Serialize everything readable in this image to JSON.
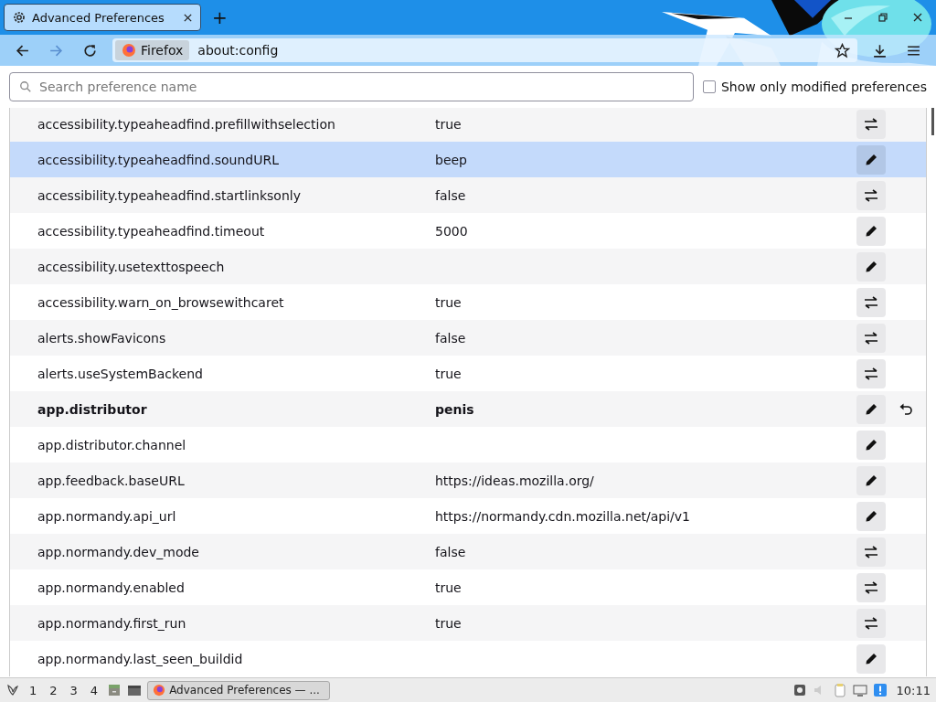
{
  "window": {
    "tab_title": "Advanced Preferences",
    "new_tab": "+"
  },
  "toolbar": {
    "identity": "Firefox",
    "url": "about:config"
  },
  "search": {
    "placeholder": "Search preference name"
  },
  "filter": {
    "label": "Show only modified preferences",
    "checked": false
  },
  "preferences": [
    {
      "name": "accessibility.typeaheadfind.prefillwithselection",
      "value": "true",
      "kind": "toggle",
      "modified": false,
      "selected": false
    },
    {
      "name": "accessibility.typeaheadfind.soundURL",
      "value": "beep",
      "kind": "edit",
      "modified": false,
      "selected": true
    },
    {
      "name": "accessibility.typeaheadfind.startlinksonly",
      "value": "false",
      "kind": "toggle",
      "modified": false,
      "selected": false
    },
    {
      "name": "accessibility.typeaheadfind.timeout",
      "value": "5000",
      "kind": "edit",
      "modified": false,
      "selected": false
    },
    {
      "name": "accessibility.usetexttospeech",
      "kind": "edit",
      "modified": false,
      "selected": false
    },
    {
      "name": "accessibility.warn_on_browsewithcaret",
      "value": "true",
      "kind": "toggle",
      "modified": false,
      "selected": false
    },
    {
      "name": "alerts.showFavicons",
      "value": "false",
      "kind": "toggle",
      "modified": false,
      "selected": false
    },
    {
      "name": "alerts.useSystemBackend",
      "value": "true",
      "kind": "toggle",
      "modified": false,
      "selected": false
    },
    {
      "name": "app.distributor",
      "value": "penis",
      "kind": "edit",
      "modified": true,
      "selected": false
    },
    {
      "name": "app.distributor.channel",
      "kind": "edit",
      "modified": false,
      "selected": false
    },
    {
      "name": "app.feedback.baseURL",
      "value": "https://ideas.mozilla.org/",
      "kind": "edit",
      "modified": false,
      "selected": false
    },
    {
      "name": "app.normandy.api_url",
      "value": "https://normandy.cdn.mozilla.net/api/v1",
      "kind": "edit",
      "modified": false,
      "selected": false
    },
    {
      "name": "app.normandy.dev_mode",
      "value": "false",
      "kind": "toggle",
      "modified": false,
      "selected": false
    },
    {
      "name": "app.normandy.enabled",
      "value": "true",
      "kind": "toggle",
      "modified": false,
      "selected": false
    },
    {
      "name": "app.normandy.first_run",
      "value": "true",
      "kind": "toggle",
      "modified": false,
      "selected": false
    },
    {
      "name": "app.normandy.last_seen_buildid",
      "kind": "edit",
      "modified": false,
      "selected": false
    }
  ],
  "taskbar": {
    "workspaces": [
      "1",
      "2",
      "3",
      "4"
    ],
    "task": "Advanced Preferences — ...",
    "clock": "10:11"
  }
}
